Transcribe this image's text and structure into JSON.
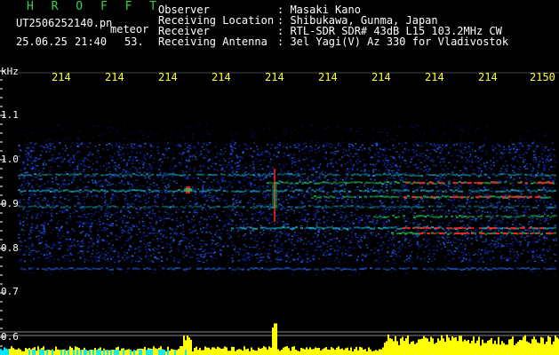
{
  "app": {
    "name": "H R O F F T",
    "filename": "UT2506252140.pn",
    "event_label": "meteor",
    "date": "25.06.25",
    "time": "21:40",
    "seconds": "53."
  },
  "info": {
    "observer_label": "Observer",
    "observer": ": Masaki Kano",
    "location_label": "Receiving Location",
    "location": ": Shibukawa, Gunma, Japan",
    "receiver_label": "Receiver",
    "receiver": ": RTL-SDR SDR# 43dB L15 103.2MHz CW",
    "antenna_label": "Receiving Antenna",
    "antenna": ": 3el Yagi(V) Az 330 for Vladivostok"
  },
  "axes": {
    "y_unit": "kHz",
    "y_ticks": [
      "1.1",
      "1.0",
      "0.9",
      "0.8",
      "0.7",
      "0.6"
    ],
    "x_ticks": [
      "214",
      "214",
      "214",
      "214",
      "214",
      "214",
      "214",
      "214",
      "214",
      "2150"
    ]
  },
  "colors": {
    "background": "#000000",
    "app_title": "#35d24a",
    "header_text": "#ffffff",
    "x_ticks": "#ffff33",
    "noise_low": "#1028c8",
    "noise_mid": "#2a6cff",
    "signal": "#18c8d8",
    "signal_strong": "#20e060",
    "echo_red": "#ff2020",
    "bottom_bar_cyan": "#00e8ff",
    "bottom_bar_yellow": "#ffff00"
  }
}
